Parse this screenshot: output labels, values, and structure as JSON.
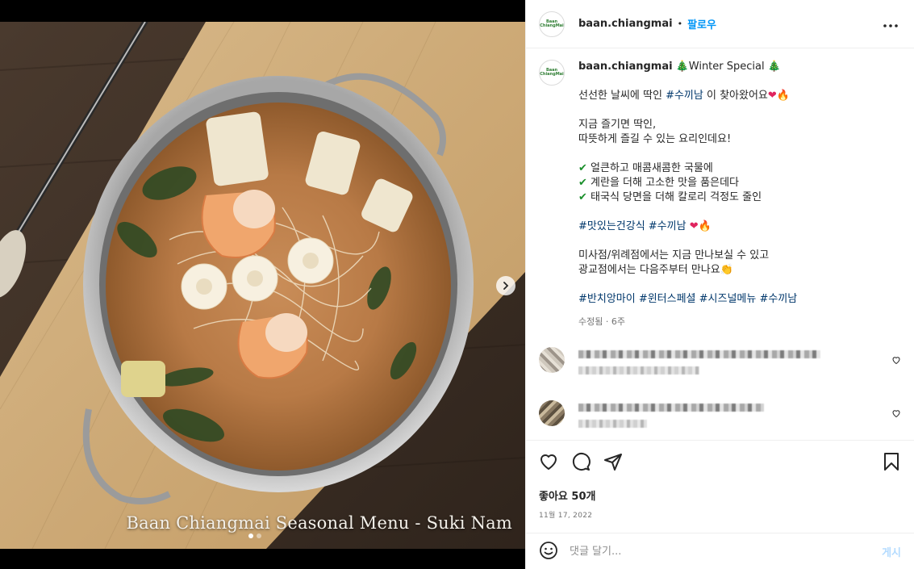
{
  "media": {
    "overlay_text": "Baan Chiangmai Seasonal Menu - Suki Nam",
    "next_icon": "chevron-right-icon",
    "slide_count": 2,
    "current_slide": 1
  },
  "header": {
    "username": "baan.chiangmai",
    "separator": "•",
    "follow_label": "팔로우",
    "avatar_text": "Baan ChiangMai",
    "more_icon": "more-horizontal-icon"
  },
  "caption": {
    "username": "baan.chiangmai",
    "tree_emoji": "🎄",
    "title": "Winter Special",
    "line1_a": "선선한 날씨에 딱인 ",
    "line1_tag": "#수끼남",
    "line1_b": " 이 찾아왔어요",
    "heart": "❤",
    "fire": "🔥",
    "line2": "지금 즐기면 딱인,",
    "line3": "따뜻하게 즐길 수 있는 요리인데요!",
    "check": "✔",
    "bullets": [
      "얼큰하고 매콤새콤한 국물에",
      "계란을 더해 고소한 맛을 품은데다",
      "태국식 당면을 더해 칼로리 걱정도 줄인"
    ],
    "tags1": "#맛있는건강식 #수끼남",
    "line4": "미사점/위례점에서는 지금 만나보실 수 있고",
    "line5": "광교점에서는 다음주부터 만나요",
    "clap": "👏",
    "tags2": "#반치앙마이 #윈터스페셜 #시즈널메뉴 #수끼남",
    "meta": "수정됨 · 6주"
  },
  "comments": [
    {
      "avatar_color": "#b9b1a6"
    },
    {
      "avatar_color": "#8a7a63"
    }
  ],
  "actions": {
    "like_icon": "heart-icon",
    "comment_icon": "comment-icon",
    "share_icon": "send-icon",
    "save_icon": "bookmark-icon",
    "likes": "좋아요 50개",
    "date": "11월 17, 2022"
  },
  "comment_box": {
    "emoji_icon": "smiley-icon",
    "placeholder": "댓글 달기...",
    "post_label": "게시"
  }
}
